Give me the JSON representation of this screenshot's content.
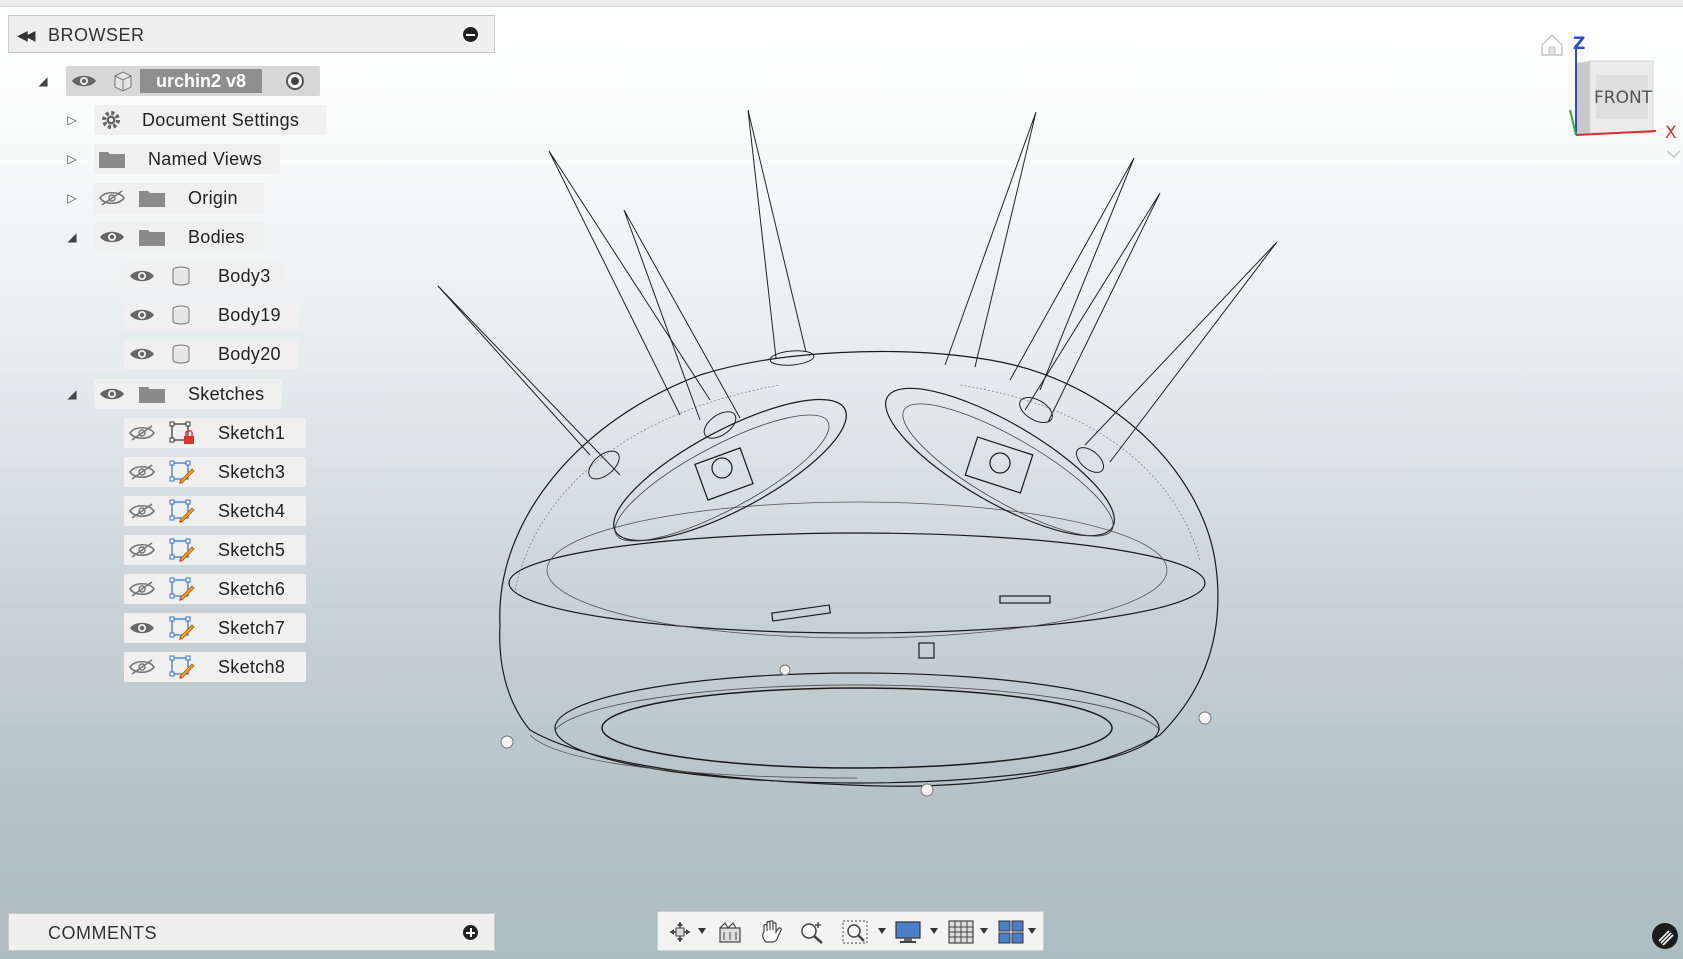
{
  "browser": {
    "title": "BROWSER",
    "root": {
      "label": "urchin2 v8"
    },
    "items": [
      {
        "label": "Document Settings",
        "icon": "gear-icon"
      },
      {
        "label": "Named Views",
        "icon": "folder-icon"
      },
      {
        "label": "Origin",
        "icon": "folder-icon",
        "visible": false
      },
      {
        "label": "Bodies",
        "icon": "folder-icon",
        "visible": true,
        "expanded": true
      }
    ],
    "bodies": [
      {
        "label": "Body3"
      },
      {
        "label": "Body19"
      },
      {
        "label": "Body20"
      }
    ],
    "sketches_folder": {
      "label": "Sketches",
      "expanded": true
    },
    "sketches": [
      {
        "label": "Sketch1",
        "visible": false,
        "locked": true
      },
      {
        "label": "Sketch3",
        "visible": false
      },
      {
        "label": "Sketch4",
        "visible": false
      },
      {
        "label": "Sketch5",
        "visible": false
      },
      {
        "label": "Sketch6",
        "visible": false
      },
      {
        "label": "Sketch7",
        "visible": true
      },
      {
        "label": "Sketch8",
        "visible": false
      }
    ]
  },
  "comments": {
    "title": "COMMENTS"
  },
  "viewcube": {
    "face": "FRONT",
    "axis_z": "Z",
    "axis_x": "X"
  },
  "colors": {
    "panel_bg": "#f0f0f0",
    "root_bg": "#8e8e8e",
    "viewport_top": "#ffffff",
    "viewport_bottom": "#aebdc3",
    "axis_z": "#2f47d6",
    "axis_x": "#d62f2f"
  },
  "toolbar": {
    "icons": [
      "orbit-icon",
      "look-at-icon",
      "pan-icon",
      "zoom-icon",
      "fit-icon",
      "display-settings-icon",
      "grid-icon",
      "viewports-icon"
    ]
  }
}
